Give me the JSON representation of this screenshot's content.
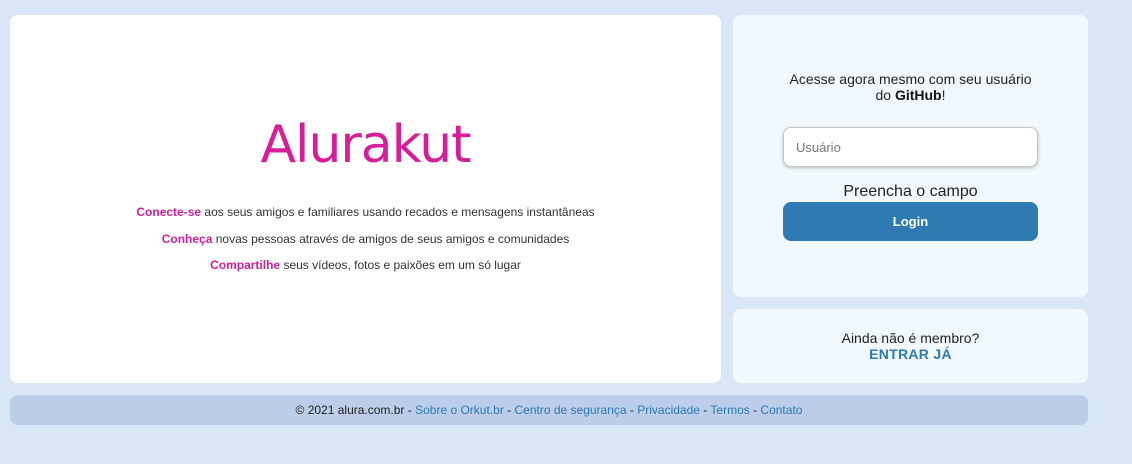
{
  "hero": {
    "logo": "Alurakut",
    "features": [
      {
        "highlight": "Conecte-se",
        "text": " aos seus amigos e familiares usando recados e mensagens instantâneas"
      },
      {
        "highlight": "Conheça",
        "text": " novas pessoas através de amigos de seus amigos e comunidades"
      },
      {
        "highlight": "Compartilhe",
        "text": " seus vídeos, fotos e paixões em um só lugar"
      }
    ]
  },
  "login": {
    "prompt_line1": "Acesse agora mesmo com seu usuário",
    "prompt_prefix": "do ",
    "prompt_bold": "GitHub",
    "prompt_suffix": "!",
    "input_placeholder": "Usuário",
    "input_value": "",
    "hint": "Preencha o campo",
    "button_label": "Login"
  },
  "signup": {
    "question": "Ainda não é membro?",
    "link_label": "ENTRAR JÁ"
  },
  "footer": {
    "copyright": "© 2021 alura.com.br",
    "separator": " - ",
    "links": [
      "Sobre o Orkut.br",
      "Centro de segurança",
      "Privacidade",
      "Termos",
      "Contato"
    ]
  },
  "colors": {
    "background": "#d9e6f6",
    "brand_pink": "#d81d99",
    "primary_blue": "#2e7bb4",
    "panel": "#f1f9fe",
    "footer": "#bbcde8"
  }
}
